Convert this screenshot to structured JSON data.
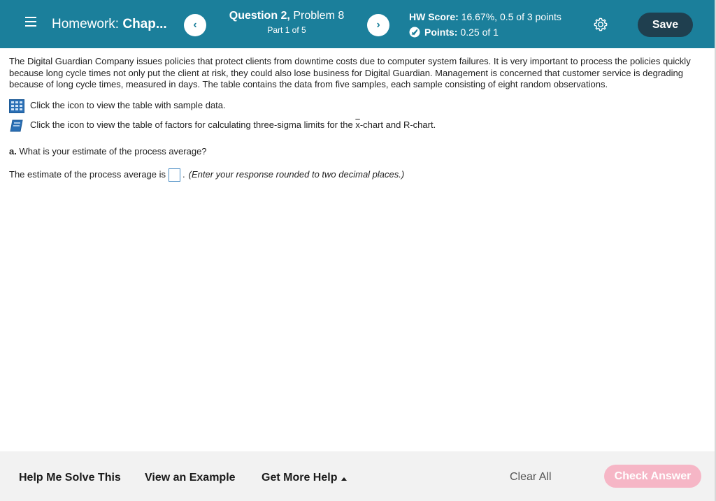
{
  "header": {
    "hw_prefix": "Homework:",
    "hw_name": "Chap...",
    "question_label": "Question 2,",
    "problem_label": "Problem 8",
    "part_label": "Part 1 of 5",
    "score_label": "HW Score:",
    "score_value": "16.67%, 0.5 of 3 points",
    "points_label": "Points:",
    "points_value": "0.25 of 1",
    "prev_symbol": "‹",
    "next_symbol": "›",
    "save_label": "Save",
    "icons": [
      "menu-icon",
      "chevron-left-icon",
      "chevron-right-icon",
      "partial-credit-icon",
      "gear-icon"
    ],
    "colors": {
      "bar": "#1b7f9b",
      "save": "#1f3f4f"
    }
  },
  "problem": {
    "intro": "The Digital Guardian Company issues policies that protect clients from downtime costs due to computer system failures. It is very important to process the policies quickly because long cycle times not only put the client at risk, they could also lose business for Digital Guardian. Management is concerned that customer service is degrading because of long cycle times, measured in days. The table contains the data from five samples, each sample consisting of eight random observations.",
    "table_link_text": "Click the icon to view the table with sample data.",
    "factors_text_before": "Click the icon to view the table of factors for calculating three-sigma limits for the ",
    "factors_xbar": "x",
    "factors_text_after": "-chart and R-chart.",
    "question_a_label": "a.",
    "question_a_text": " What is your estimate of the process average?",
    "answer_prefix": "The estimate of the process average is",
    "answer_value": "",
    "answer_suffix": ".",
    "answer_hint": "(Enter your response rounded to two decimal places.)"
  },
  "footer": {
    "help_solve": "Help Me Solve This",
    "view_example": "View an Example",
    "more_help": "Get More Help",
    "clear_all": "Clear All",
    "check_answer": "Check Answer",
    "colors": {
      "check_answer_disabled": "#f6b6c6"
    }
  }
}
